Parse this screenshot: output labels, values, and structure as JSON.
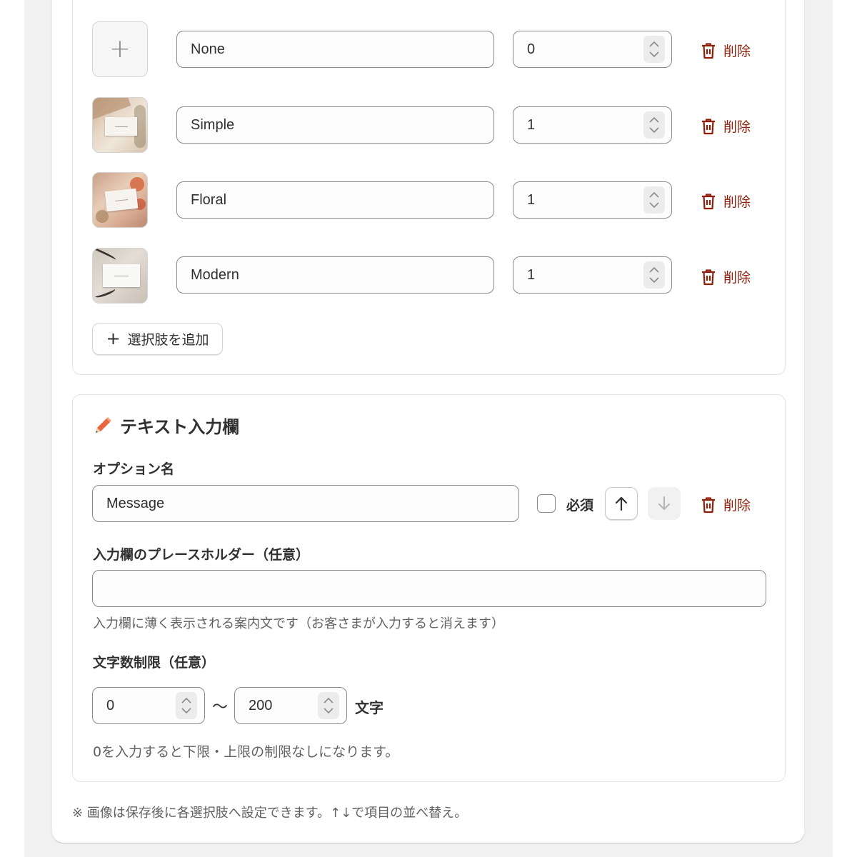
{
  "choices": [
    {
      "name": "None",
      "price": "0",
      "thumbnail": "add-image-icon",
      "delete_label": "削除"
    },
    {
      "name": "Simple",
      "price": "1",
      "thumbnail": "simple-card-photo",
      "delete_label": "削除"
    },
    {
      "name": "Floral",
      "price": "1",
      "thumbnail": "floral-card-photo",
      "delete_label": "削除"
    },
    {
      "name": "Modern",
      "price": "1",
      "thumbnail": "modern-card-photo",
      "delete_label": "削除"
    }
  ],
  "add_choice_label": "選択肢を追加",
  "text_section": {
    "title": "テキスト入力欄",
    "title_icon": "pencil-icon",
    "option_name_label": "オプション名",
    "option_name_value": "Message",
    "required_label": "必須",
    "required_checked": false,
    "delete_label": "削除",
    "placeholder_label": "入力欄のプレースホルダー（任意）",
    "placeholder_value": "",
    "placeholder_help": "入力欄に薄く表示される案内文です（お客さまが入力すると消えます）",
    "char_limit_label": "文字数制限（任意）",
    "char_min": "0",
    "char_separator": "〜",
    "char_max": "200",
    "char_unit": "文字",
    "char_limit_help": "0を入力すると下限・上限の制限なしになります。"
  },
  "footnote": "※ 画像は保存後に各選択肢へ設定できます。↑↓で項目の並べ替え。",
  "colors": {
    "danger": "#8e1f0b",
    "pencil_accent": "#e8663d",
    "border": "#8a8a8a",
    "muted_text": "#616161"
  }
}
